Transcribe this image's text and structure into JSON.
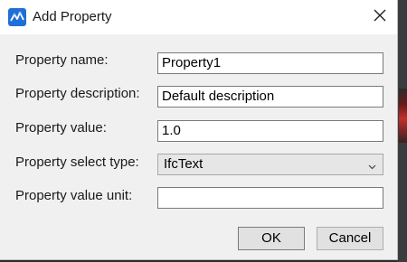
{
  "dialog": {
    "title": "Add Property",
    "fields": [
      {
        "label": "Property name:",
        "value": "Property1"
      },
      {
        "label": "Property description:",
        "value": "Default description"
      },
      {
        "label": "Property value:",
        "value": "1.0"
      },
      {
        "label": "Property select type:",
        "value": "IfcText"
      },
      {
        "label": "Property value unit:",
        "value": ""
      }
    ],
    "buttons": {
      "ok_label": "OK",
      "cancel_label": "Cancel"
    }
  },
  "icons": {
    "app": "app-logo-icon",
    "close": "close-icon",
    "dropdown": "chevron-down-icon"
  },
  "colors": {
    "dialog_bg": "#f0f0f0",
    "title_bar_bg": "#ffffff",
    "app_icon_bg": "#1f6fd6"
  }
}
